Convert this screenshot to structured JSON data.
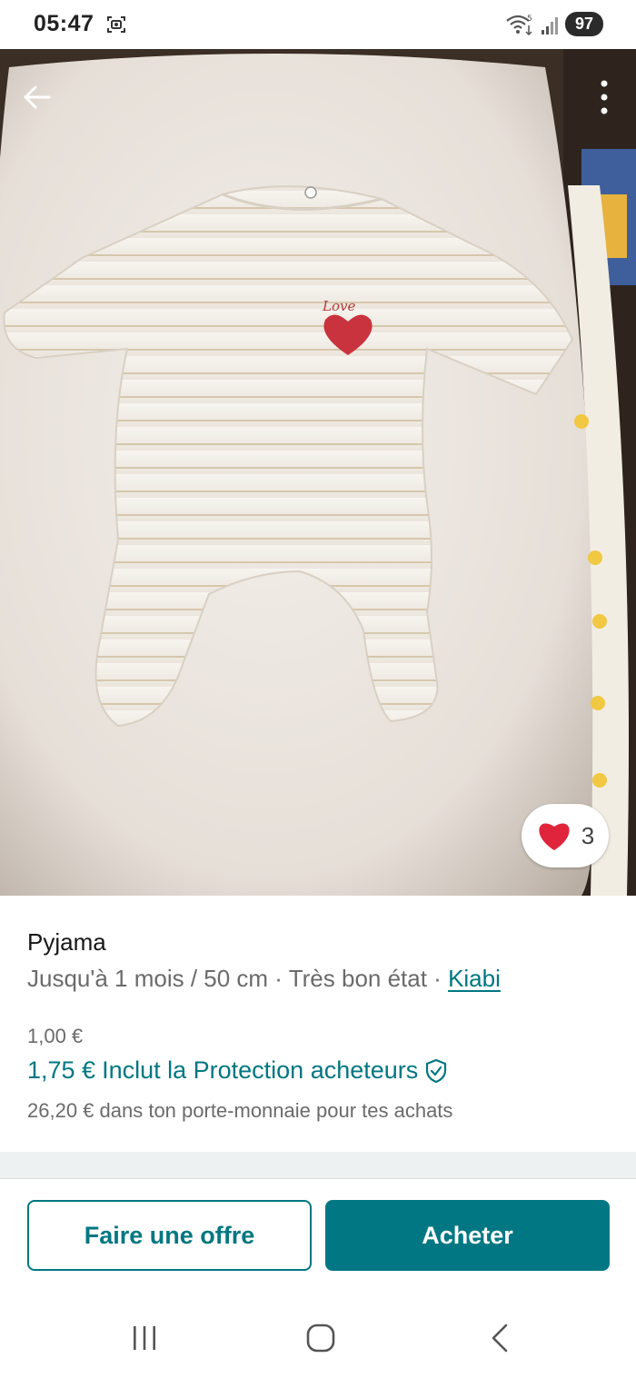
{
  "status_bar": {
    "time": "05:47",
    "battery": "97",
    "icons": [
      "screenshot-icon",
      "wifi-icon",
      "signal-icon",
      "battery-icon"
    ]
  },
  "photo": {
    "back_icon": "arrow-left-icon",
    "menu_icon": "more-vertical-icon",
    "favorite": {
      "icon": "heart-icon",
      "count": "3",
      "color": "#e0243b"
    }
  },
  "item": {
    "title": "Pyjama",
    "size": "Jusqu'à 1 mois / 50 cm",
    "separator": " · ",
    "condition": "Très bon état",
    "brand": "Kiabi",
    "price": "1,00 €",
    "total_price": "1,75 €",
    "protection_label": "Inclut la Protection acheteurs",
    "protection_icon": "shield-check-icon",
    "wallet_note": "26,20 € dans ton porte-monnaie pour tes achats"
  },
  "actions": {
    "offer_label": "Faire une offre",
    "buy_label": "Acheter"
  },
  "nav_bar": {
    "icons": [
      "recent-apps-icon",
      "home-icon",
      "back-icon"
    ]
  },
  "colors": {
    "accent": "#007782",
    "heart": "#e0243b",
    "muted_text": "#6b6b6b"
  }
}
